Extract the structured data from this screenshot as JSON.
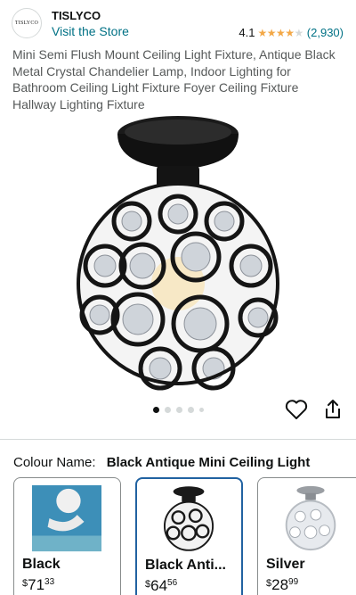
{
  "store": {
    "logo_text": "TISLYCO",
    "brand": "TISLYCO",
    "visit_link": "Visit the Store",
    "rating": "4.1",
    "stars": 4,
    "rating_count": "(2,930)"
  },
  "product": {
    "title": "Mini Semi Flush Mount Ceiling Light Fixture, Antique Black Metal Crystal Chandelier Lamp, Indoor Lighting for Bathroom Ceiling Light Fixture Foyer Ceiling Fixture Hallway Lighting Fixture"
  },
  "gallery": {
    "image_count": 5,
    "active_index": 0
  },
  "colour": {
    "label": "Colour Name:",
    "selected": "Black Antique Mini Ceiling Light"
  },
  "variants": [
    {
      "name": "Black",
      "currency": "$",
      "price_whole": "71",
      "price_fraction": "33",
      "selected": false
    },
    {
      "name": "Black Anti...",
      "currency": "$",
      "price_whole": "64",
      "price_fraction": "56",
      "selected": true
    },
    {
      "name": "Silver",
      "currency": "$",
      "price_whole": "28",
      "price_fraction": "99",
      "selected": false
    }
  ],
  "icons": {
    "heart": "heart-icon",
    "share": "share-icon"
  },
  "colors": {
    "link": "#007185",
    "star": "#f3a847",
    "selected_border": "#2162a1"
  }
}
